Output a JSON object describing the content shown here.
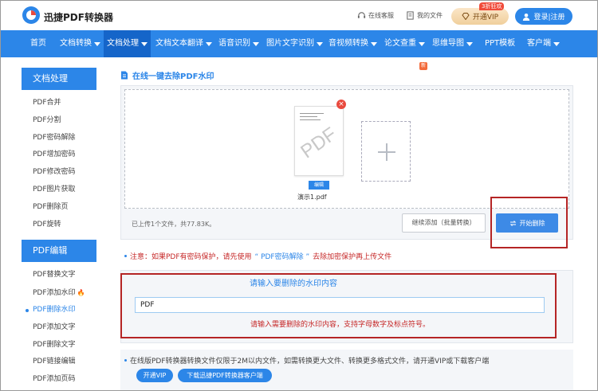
{
  "header": {
    "brand": "迅捷PDF转换器",
    "service_label": "在线客服",
    "files_label": "我的文件",
    "vip_label": "开通VIP",
    "vip_badge": "3折狂欢",
    "login_label": "登录|注册"
  },
  "nav": {
    "items": [
      {
        "label": "首页"
      },
      {
        "label": "文档转换"
      },
      {
        "label": "文档处理"
      },
      {
        "label": "文档文本翻译"
      },
      {
        "label": "语音识别"
      },
      {
        "label": "图片文字识别"
      },
      {
        "label": "音视频转换"
      },
      {
        "label": "论文查重"
      },
      {
        "label": "思维导图"
      },
      {
        "label": "PPT模板"
      },
      {
        "label": "客户端"
      }
    ],
    "new_badge": "新"
  },
  "sidebar": {
    "section1_title": "文档处理",
    "section1_items": [
      "PDF合并",
      "PDF分割",
      "PDF密码解除",
      "PDF增加密码",
      "PDF修改密码",
      "PDF图片获取",
      "PDF删除页",
      "PDF旋转"
    ],
    "section2_title": "PDF编辑",
    "section2_items": [
      "PDF替换文字",
      "PDF添加水印",
      "PDF删除水印",
      "PDF添加文字",
      "PDF删除文字",
      "PDF链接编辑",
      "PDF添加页码"
    ]
  },
  "main": {
    "title": "在线一键去除PDF水印",
    "thumb_watermark": "PDF",
    "edit_tag": "编辑",
    "file_name": "演示1.pdf",
    "upload_info": "已上传1个文件，共77.83K。",
    "continue_label": "继续添加（批量转换）",
    "start_label": "开始删除",
    "notice_prefix": "注意：如果PDF有密码保护，请先使用",
    "notice_link": "“ PDF密码解除 ”",
    "notice_suffix": "去除加密保护再上传文件",
    "wm_title": "请输入要删除的水印内容",
    "wm_value": "PDF",
    "wm_hint": "请输入需要删除的水印内容，支持字母数字及标点符号。",
    "footer_text": "在线版PDF转换器转换文件仅限于2M以内文件，如需转换更大文件、转换更多格式文件，请开通VIP或下载客户端",
    "footer_vip": "开通VIP",
    "footer_download": "下载迅捷PDF转换器客户端"
  },
  "colors": {
    "brand_blue": "#2c86e8",
    "highlight_red": "#b52525",
    "notice_red": "#c62828"
  }
}
